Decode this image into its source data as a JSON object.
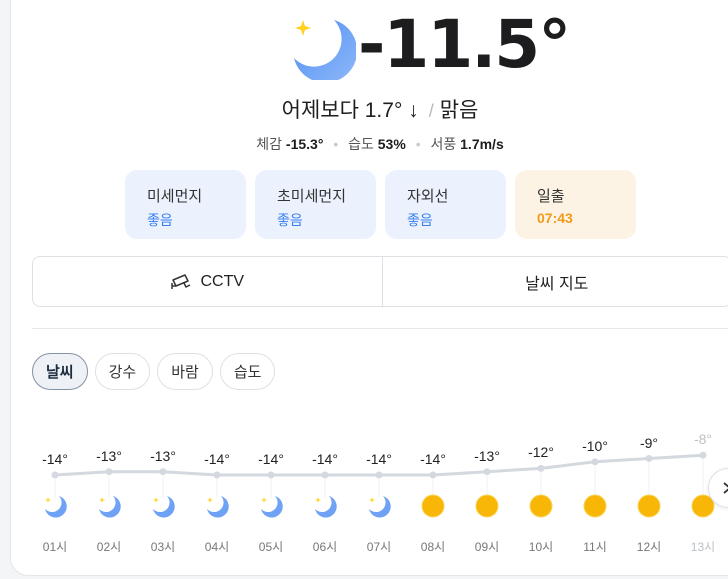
{
  "current": {
    "temperature": "-11.5°",
    "condition_icon": "crescent-moon-icon",
    "compare_text": "어제보다 1.7° ↓",
    "condition": "맑음",
    "feels_like_label": "체감",
    "feels_like": "-15.3°",
    "humidity_label": "습도",
    "humidity": "53%",
    "wind_label": "서풍",
    "wind": "1.7m/s"
  },
  "tiles": [
    {
      "label": "미세먼지",
      "value": "좋음"
    },
    {
      "label": "초미세먼지",
      "value": "좋음"
    },
    {
      "label": "자외선",
      "value": "좋음"
    },
    {
      "label": "일출",
      "value": "07:43"
    }
  ],
  "buttons": {
    "cctv": "CCTV",
    "map": "날씨 지도"
  },
  "chips": [
    "날씨",
    "강수",
    "바람",
    "습도"
  ],
  "active_chip": "날씨",
  "hourly": [
    {
      "time": "01시",
      "temp": "-14°",
      "value": -14,
      "icon": "moon"
    },
    {
      "time": "02시",
      "temp": "-13°",
      "value": -13,
      "icon": "moon"
    },
    {
      "time": "03시",
      "temp": "-13°",
      "value": -13,
      "icon": "moon"
    },
    {
      "time": "04시",
      "temp": "-14°",
      "value": -14,
      "icon": "moon"
    },
    {
      "time": "05시",
      "temp": "-14°",
      "value": -14,
      "icon": "moon"
    },
    {
      "time": "06시",
      "temp": "-14°",
      "value": -14,
      "icon": "moon"
    },
    {
      "time": "07시",
      "temp": "-14°",
      "value": -14,
      "icon": "moon"
    },
    {
      "time": "08시",
      "temp": "-14°",
      "value": -14,
      "icon": "sun"
    },
    {
      "time": "09시",
      "temp": "-13°",
      "value": -13,
      "icon": "sun"
    },
    {
      "time": "10시",
      "temp": "-12°",
      "value": -12,
      "icon": "sun"
    },
    {
      "time": "11시",
      "temp": "-10°",
      "value": -10,
      "icon": "sun"
    },
    {
      "time": "12시",
      "temp": "-9°",
      "value": -9,
      "icon": "sun"
    },
    {
      "time": "13시",
      "temp": "-8°",
      "value": -8,
      "icon": "sun"
    }
  ],
  "colors": {
    "accent": "#3a7ef0",
    "sunrise": "#f39a19",
    "moon": "#6fa2f4",
    "sun": "#f8b707",
    "line": "#d3d9df"
  }
}
